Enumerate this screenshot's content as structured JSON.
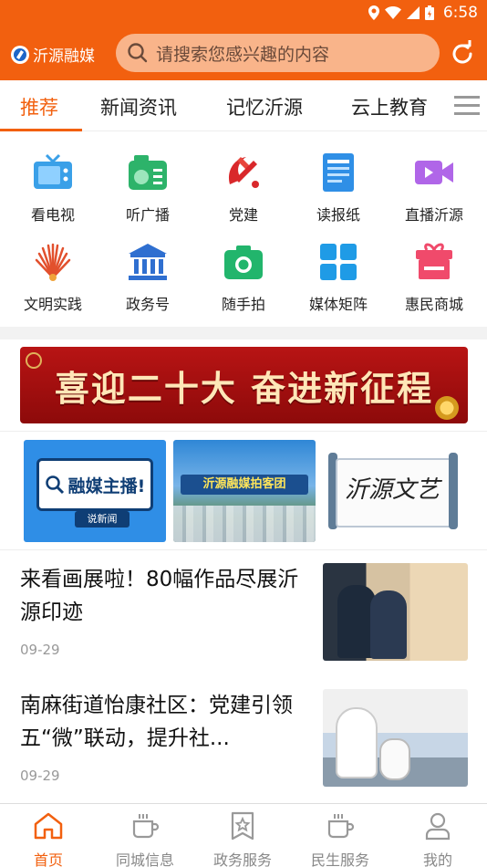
{
  "status_bar": {
    "time": "6:58"
  },
  "header": {
    "brand_name": "沂源融媒",
    "search_placeholder": "请搜索您感兴趣的内容"
  },
  "tabs": [
    {
      "label": "推荐",
      "active": true
    },
    {
      "label": "新闻资讯",
      "active": false
    },
    {
      "label": "记忆沂源",
      "active": false
    },
    {
      "label": "云上教育",
      "active": false
    }
  ],
  "grid": [
    {
      "label": "看电视",
      "icon": "tv-icon"
    },
    {
      "label": "听广播",
      "icon": "radio-icon"
    },
    {
      "label": "党建",
      "icon": "party-emblem-icon"
    },
    {
      "label": "读报纸",
      "icon": "newspaper-icon"
    },
    {
      "label": "直播沂源",
      "icon": "live-video-icon"
    },
    {
      "label": "文明实践",
      "icon": "civilization-fan-icon"
    },
    {
      "label": "政务号",
      "icon": "government-building-icon"
    },
    {
      "label": "随手拍",
      "icon": "camera-icon"
    },
    {
      "label": "媒体矩阵",
      "icon": "matrix-grid-icon"
    },
    {
      "label": "惠民商城",
      "icon": "gift-box-icon"
    }
  ],
  "banner": {
    "text": "喜迎二十大 奋进新征程"
  },
  "cards": [
    {
      "title": "融媒主播!",
      "subtitle": "说新闻"
    },
    {
      "title": "沂源融媒拍客团"
    },
    {
      "title": "沂源文艺"
    }
  ],
  "news": [
    {
      "title": "来看画展啦！80幅作品尽展沂源印迹",
      "date": "09-29"
    },
    {
      "title": "南麻街道怡康社区：党建引领 五“微”联动，提升社...",
      "date": "09-29"
    }
  ],
  "bottom_nav": [
    {
      "label": "首页",
      "icon": "home-icon",
      "active": true
    },
    {
      "label": "同城信息",
      "icon": "cup-icon",
      "active": false
    },
    {
      "label": "政务服务",
      "icon": "star-bookmark-icon",
      "active": false
    },
    {
      "label": "民生服务",
      "icon": "cup-icon",
      "active": false
    },
    {
      "label": "我的",
      "icon": "user-icon",
      "active": false
    }
  ],
  "colors": {
    "accent": "#f2600f",
    "search_bg": "#f9b48a",
    "banner_red": "#b81414"
  }
}
